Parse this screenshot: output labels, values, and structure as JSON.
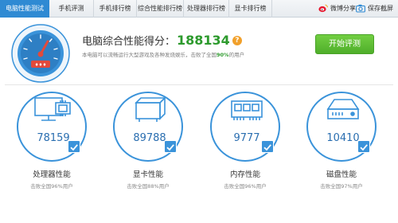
{
  "tabs": [
    {
      "label": "电脑性能测试",
      "active": true
    },
    {
      "label": "手机评测",
      "active": false
    },
    {
      "label": "手机排行榜",
      "active": false
    },
    {
      "label": "综合性能排行榜",
      "active": false
    },
    {
      "label": "处理器排行榜",
      "active": false
    },
    {
      "label": "显卡排行榜",
      "active": false
    }
  ],
  "toolbar": {
    "share_label": "微博分享",
    "save_label": "保存截屏",
    "share_icon": "weibo-icon",
    "save_icon": "camera-icon"
  },
  "header": {
    "gauge_icon": "speedometer-icon",
    "score_title": "电脑综合性能得分：",
    "score_value": "188134",
    "help_label": "?",
    "desc_prefix": "本电脑可以流畅运行大型游戏及各种发烧娱乐，击败了全国",
    "desc_percent": "90%",
    "desc_suffix": "的用户",
    "start_button": "开始评测"
  },
  "components": [
    {
      "icon": "cpu-monitor-icon",
      "score": "78159",
      "name": "处理器性能",
      "rank": "击败全国96%用户"
    },
    {
      "icon": "graphics-card-icon",
      "score": "89788",
      "name": "显卡性能",
      "rank": "击败全国88%用户"
    },
    {
      "icon": "memory-icon",
      "score": "9777",
      "name": "内存性能",
      "rank": "击败全国96%用户"
    },
    {
      "icon": "hard-disk-icon",
      "score": "10410",
      "name": "磁盘性能",
      "rank": "击败全国97%用户"
    }
  ],
  "colors": {
    "accent": "#2f8ad3",
    "score_green": "#2d9a2d",
    "button_green": "#5bbd33",
    "help_orange": "#f1a02a",
    "gauge_red": "#e24a3b"
  }
}
